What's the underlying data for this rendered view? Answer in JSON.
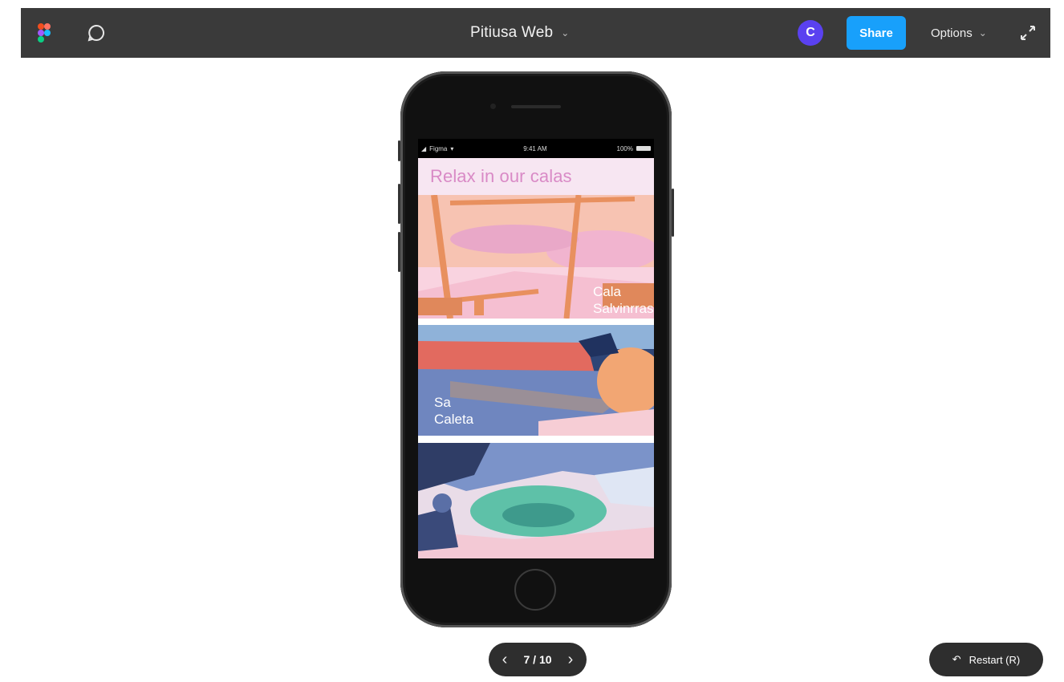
{
  "toolbar": {
    "title": "Pitiusa Web",
    "avatar_initial": "C",
    "share_label": "Share",
    "options_label": "Options",
    "icons": [
      "figma-logo-icon",
      "comment-icon",
      "chevron-down-icon",
      "expand-icon"
    ]
  },
  "colors": {
    "toolbar_bg": "#3a3a3a",
    "share_blue": "#18a0fb",
    "avatar_purple": "#5a41f0",
    "heading_pink": "#d98ac6"
  },
  "phone": {
    "status_bar": {
      "carrier": "Figma",
      "time": "9:41 AM",
      "battery": "100%"
    },
    "heading": "Relax in our calas",
    "cards": [
      {
        "label": "Cala Salvinrras"
      },
      {
        "label": "Sa Caleta"
      },
      {
        "label": ""
      }
    ]
  },
  "pager": {
    "current": "7",
    "total": "10",
    "text": "7 / 10"
  },
  "restart": {
    "label": "Restart (R)"
  }
}
